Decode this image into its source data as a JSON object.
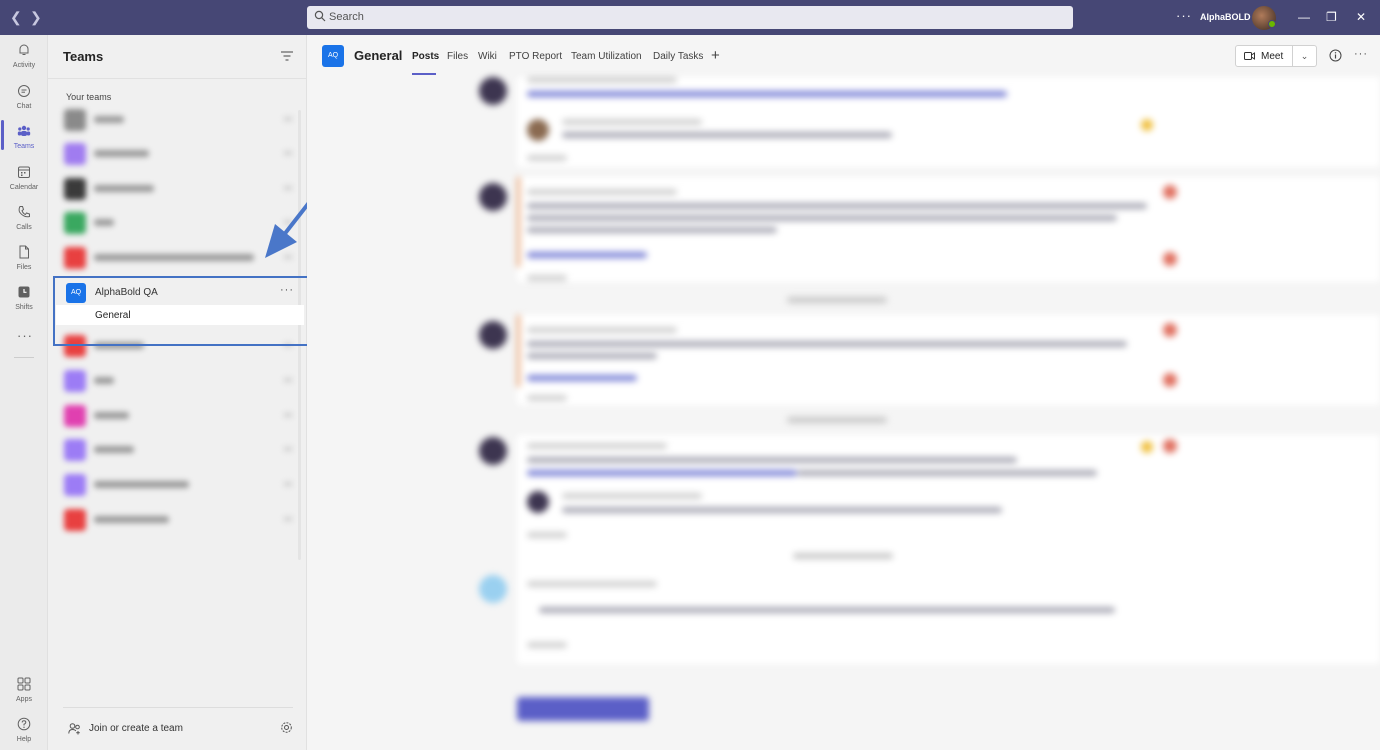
{
  "titlebar": {
    "search_placeholder": "Search",
    "org_name": "AlphaBOLD",
    "more_label": "···"
  },
  "rail": {
    "items": [
      {
        "label": "Activity",
        "icon": "bell-icon"
      },
      {
        "label": "Chat",
        "icon": "chat-icon"
      },
      {
        "label": "Teams",
        "icon": "teams-icon",
        "active": true
      },
      {
        "label": "Calendar",
        "icon": "calendar-icon"
      },
      {
        "label": "Calls",
        "icon": "phone-icon"
      },
      {
        "label": "Files",
        "icon": "file-icon"
      },
      {
        "label": "Shifts",
        "icon": "clock-icon"
      },
      {
        "label": "Apps",
        "icon": "apps-icon"
      },
      {
        "label": "Help",
        "icon": "help-icon"
      }
    ],
    "more_label": "···"
  },
  "teams_panel": {
    "title": "Teams",
    "section_label": "Your teams",
    "expanded_team": {
      "avatar_text": "AQ",
      "name": "AlphaBold QA",
      "more_label": "···",
      "channel": "General"
    },
    "join_label": "Join or create a team",
    "blurred_team_colors": [
      "#8a8a8a",
      "#a07cf0",
      "#3a3a3a",
      "#3aa860",
      "#e84040",
      "#e84040",
      "#9c7cf5",
      "#e040b0",
      "#9c7cf5",
      "#9c7cf5",
      "#e84040"
    ]
  },
  "channel_header": {
    "avatar_text": "AQ",
    "title": "General",
    "tabs": [
      "Posts",
      "Files",
      "Wiki",
      "PTO Report",
      "Team Utilization",
      "Daily Tasks"
    ],
    "add_tab": "+",
    "meet_label": "Meet",
    "meet_dropdown": "⌄",
    "more_label": "···"
  },
  "colors": {
    "titlebar": "#464775",
    "accent": "#5b5fc7",
    "team_avatar": "#1a73e8",
    "highlight_box": "#4472c4",
    "arrow": "#4a77c9"
  }
}
